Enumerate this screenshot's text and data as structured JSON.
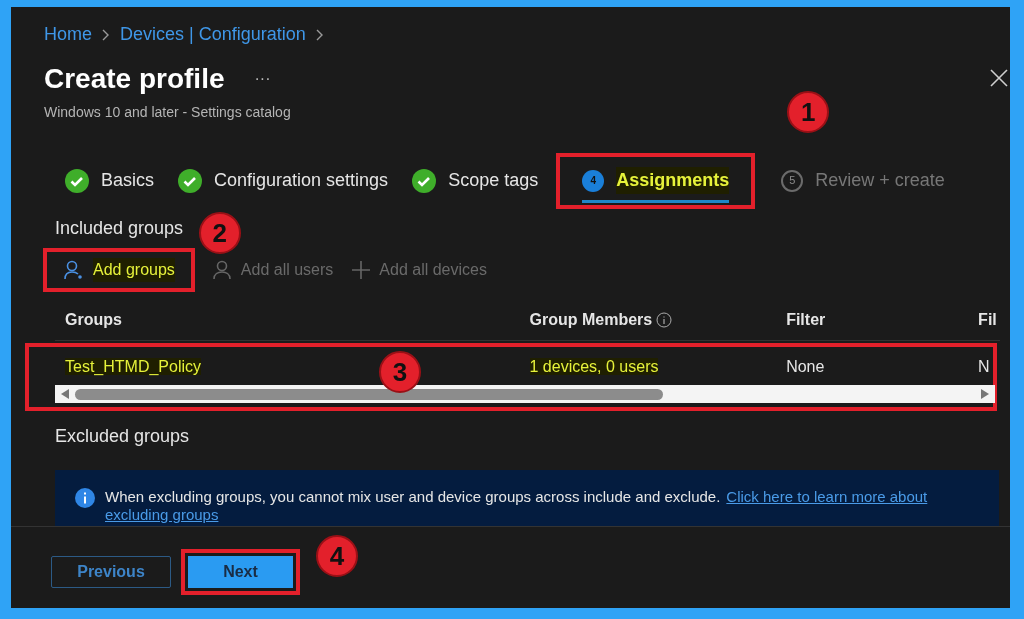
{
  "breadcrumb": [
    {
      "label": "Home"
    },
    {
      "label": "Devices | Configuration"
    }
  ],
  "title": "Create profile",
  "more": "···",
  "subtitle": "Windows 10 and later - Settings catalog",
  "steps": [
    {
      "label": "Basics",
      "kind": "done",
      "selected": false
    },
    {
      "label": "Configuration settings",
      "kind": "done",
      "selected": false
    },
    {
      "label": "Scope tags",
      "kind": "done",
      "selected": false
    },
    {
      "label": "Assignments",
      "number": "4",
      "kind": "current",
      "selected": true,
      "highlighted": true,
      "callout": "1"
    },
    {
      "label": "Review + create",
      "number": "5",
      "kind": "pending",
      "selected": false
    }
  ],
  "included_groups": {
    "title": "Included groups",
    "toolbar": [
      {
        "label": "Add groups",
        "kind": "group",
        "disabled": false,
        "highlighted": true,
        "callout": "2"
      },
      {
        "label": "Add all users",
        "kind": "user",
        "disabled": true
      },
      {
        "label": "Add all devices",
        "kind": "plus",
        "disabled": true
      }
    ],
    "table": {
      "columns": [
        "Groups",
        "Group Members",
        "Filter",
        "Fil"
      ],
      "rows": [
        {
          "callout": "3",
          "cells": [
            {
              "text": "Test_HTMD_Policy",
              "highlighted": true
            },
            {
              "text": "1 devices, 0 users",
              "highlighted": true
            },
            {
              "text": "None",
              "highlighted": false
            },
            {
              "text": "N",
              "highlighted": false
            }
          ]
        }
      ]
    }
  },
  "excluded_groups": {
    "title": "Excluded groups",
    "banner": {
      "text": "When excluding groups, you cannot mix user and device groups across include and exclude.",
      "link_lines": [
        "Click here to learn more about",
        "excluding groups"
      ]
    }
  },
  "footer": [
    {
      "label": "Previous",
      "kind": "secondary"
    },
    {
      "label": "Next",
      "kind": "primary",
      "callout": "4"
    }
  ]
}
